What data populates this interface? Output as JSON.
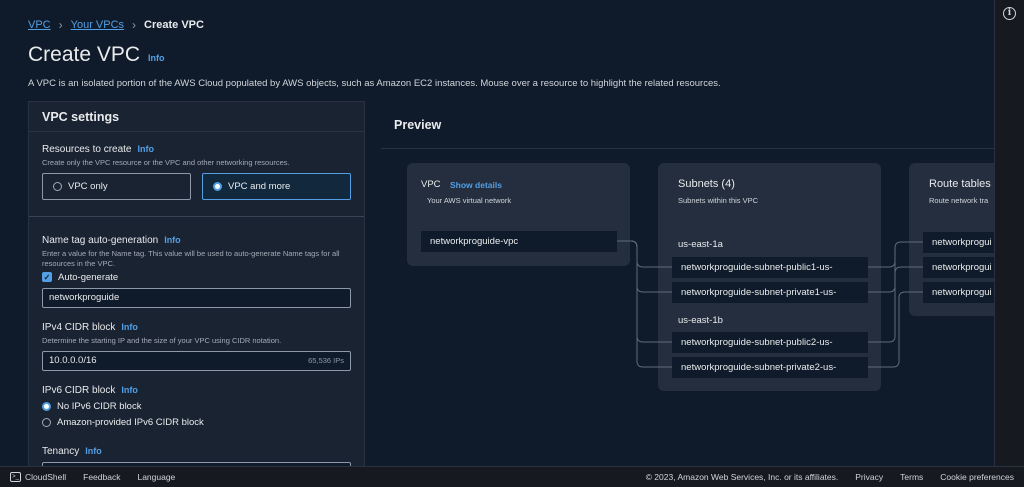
{
  "breadcrumb": {
    "vpc": "VPC",
    "your_vpcs": "Your VPCs",
    "current": "Create VPC"
  },
  "page": {
    "title": "Create VPC",
    "info": "Info",
    "description": "A VPC is an isolated portion of the AWS Cloud populated by AWS objects, such as Amazon EC2 instances. Mouse over a resource to highlight the related resources."
  },
  "settings": {
    "heading": "VPC settings",
    "resources": {
      "label": "Resources to create",
      "info": "Info",
      "sub": "Create only the VPC resource or the VPC and other networking resources.",
      "option_vpc_only": "VPC only",
      "option_vpc_more": "VPC and more",
      "selected": "VPC and more"
    },
    "name_tag": {
      "label": "Name tag auto-generation",
      "info": "Info",
      "sub": "Enter a value for the Name tag. This value will be used to auto-generate Name tags for all resources in the VPC.",
      "auto_label": "Auto-generate",
      "auto_checked": true,
      "value": "networkproguide"
    },
    "ipv4": {
      "label": "IPv4 CIDR block",
      "info": "Info",
      "sub": "Determine the starting IP and the size of your VPC using CIDR notation.",
      "value": "10.0.0.0/16",
      "hint": "65,536 IPs"
    },
    "ipv6": {
      "label": "IPv6 CIDR block",
      "info": "Info",
      "option_none": "No IPv6 CIDR block",
      "option_amazon": "Amazon-provided IPv6 CIDR block",
      "selected": "No IPv6 CIDR block"
    },
    "tenancy": {
      "label": "Tenancy",
      "info": "Info"
    }
  },
  "preview": {
    "heading": "Preview",
    "vpc": {
      "title": "VPC",
      "show_details": "Show details",
      "sub": "Your AWS virtual network",
      "node": "networkproguide-vpc"
    },
    "subnets": {
      "title": "Subnets (4)",
      "sub": "Subnets within this VPC",
      "az1": "us-east-1a",
      "az2": "us-east-1b",
      "nodes": [
        "networkproguide-subnet-public1-us-",
        "networkproguide-subnet-private1-us-",
        "networkproguide-subnet-public2-us-",
        "networkproguide-subnet-private2-us-"
      ]
    },
    "route_tables": {
      "title": "Route tables",
      "sub": "Route network tra",
      "nodes": [
        "networkprogui",
        "networkprogui",
        "networkprogui"
      ]
    }
  },
  "footer": {
    "cloudshell": "CloudShell",
    "feedback": "Feedback",
    "language": "Language",
    "copyright": "© 2023, Amazon Web Services, Inc. or its affiliates.",
    "privacy": "Privacy",
    "terms": "Terms",
    "cookies": "Cookie preferences"
  },
  "icons": {
    "info": "info-circle-icon",
    "check": "checkmark-icon",
    "cloudshell": "terminal-icon"
  }
}
